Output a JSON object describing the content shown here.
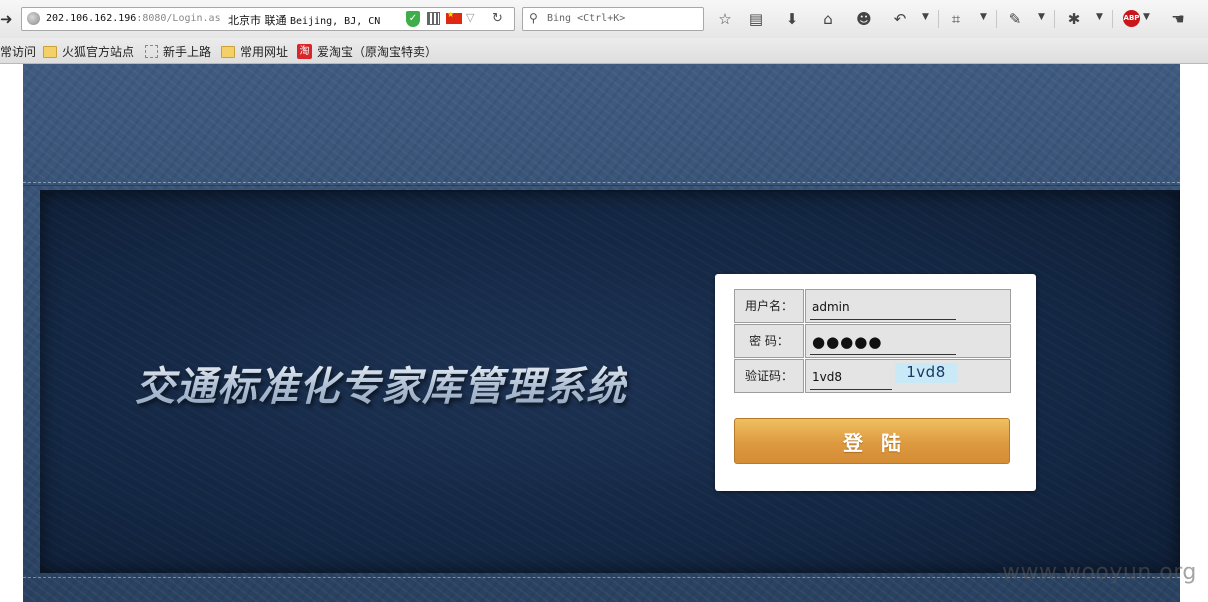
{
  "browser": {
    "url": {
      "main": "202.106.162.196",
      "rest": ":8080/Login.as"
    },
    "geo": {
      "city": "北京市 联通",
      "location": "Beijing, BJ, CN"
    },
    "search_placeholder": "Bing <Ctrl+K>",
    "bookmarks": [
      {
        "label": "常访问",
        "icon": "none"
      },
      {
        "label": "火狐官方站点",
        "icon": "folder-icon"
      },
      {
        "label": "新手上路",
        "icon": "blank-page-icon"
      },
      {
        "label": "常用网址",
        "icon": "folder-icon"
      },
      {
        "label": "爱淘宝（原淘宝特卖）",
        "icon": "taobao-icon"
      }
    ],
    "taobao_icon_glyph": "淘",
    "abp_label": "ABP"
  },
  "page": {
    "system_title": "交通标准化专家库管理系统",
    "login": {
      "username_label": "用户名：",
      "username_value": "admin",
      "password_label": "密 码：",
      "password_value": "●●●●●",
      "captcha_label": "验证码：",
      "captcha_value": "1vd8",
      "captcha_image_text": "1vd8",
      "submit_label": "登陆"
    }
  },
  "watermark": "www.wooyun.org",
  "colors": {
    "accent_button": "#dd9a40",
    "banner_blue": "#2f4a6c",
    "panel_navy": "#142845"
  }
}
